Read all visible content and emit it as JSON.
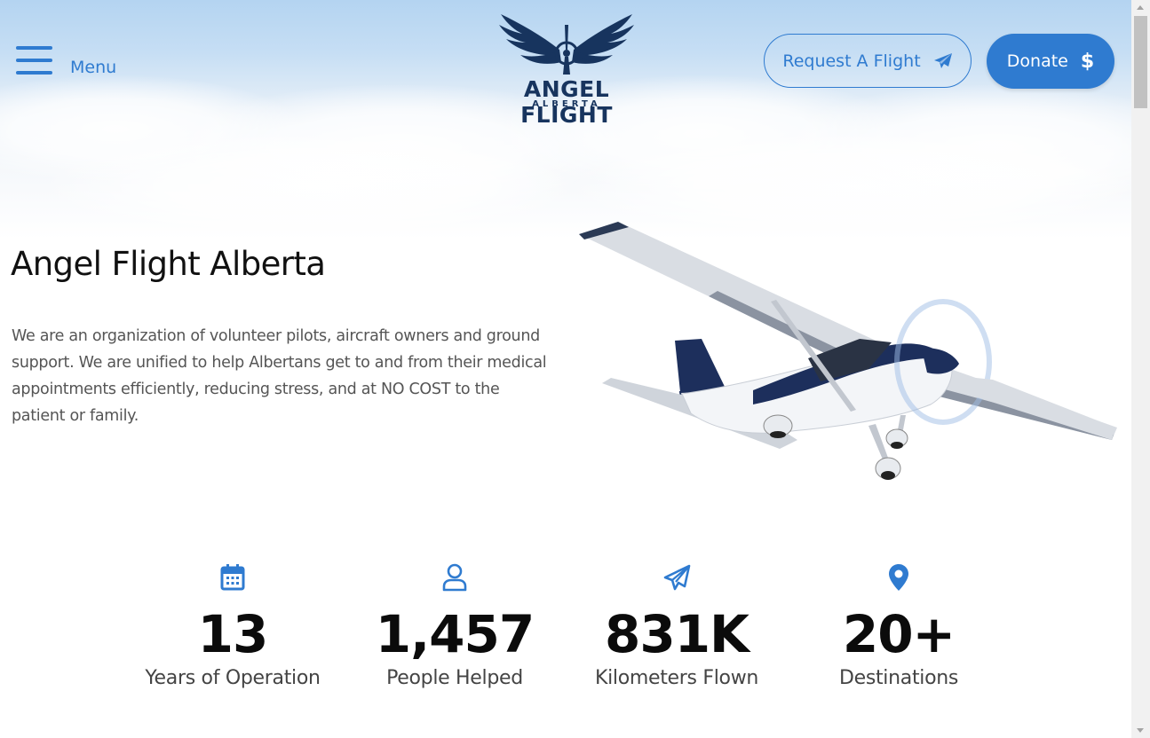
{
  "header": {
    "menu_label": "Menu",
    "logo": {
      "name": "ANGEL FLIGHT",
      "sub": "ALBERTA"
    },
    "request_button": "Request A Flight",
    "donate_button": "Donate",
    "donate_symbol": "$"
  },
  "hero": {
    "title": "Angel Flight Alberta",
    "description": "We are an organization of volunteer pilots, aircraft owners and ground support. We are unified to help Albertans get to and from their medical appointments efficiently, reducing stress, and at NO COST to the patient or family."
  },
  "stats": [
    {
      "icon": "calendar-icon",
      "value": "13",
      "label": "Years of Operation"
    },
    {
      "icon": "user-icon",
      "value": "1,457",
      "label": "People Helped"
    },
    {
      "icon": "paper-plane-icon",
      "value": "831K",
      "label": "Kilometers Flown"
    },
    {
      "icon": "map-pin-icon",
      "value": "20+",
      "label": "Destinations"
    }
  ],
  "colors": {
    "accent": "#2f7bd0",
    "logo_navy": "#17345e",
    "text_dark": "#111111",
    "text_body": "#555555"
  }
}
